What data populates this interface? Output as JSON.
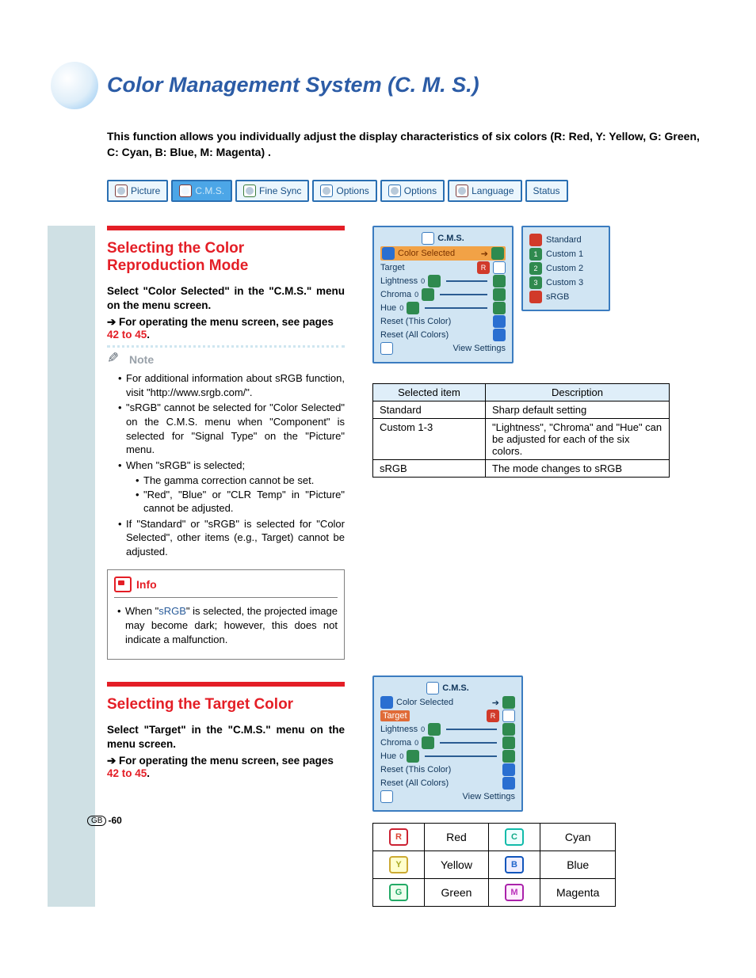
{
  "page": {
    "title": "Color Management System (C. M. S.)",
    "intro": "This function allows you individually adjust the display characteristics of six colors (R: Red, Y: Yellow, G: Green, C: Cyan, B: Blue, M: Magenta) .",
    "footer_region": "GB",
    "footer_page": "-60"
  },
  "tabs": [
    {
      "label": "Picture"
    },
    {
      "label": "C.M.S."
    },
    {
      "label": "Fine Sync"
    },
    {
      "label": "Options"
    },
    {
      "label": "Options"
    },
    {
      "label": "Language"
    },
    {
      "label": "Status"
    }
  ],
  "section1": {
    "title": "Selecting the Color Reproduction Mode",
    "lead": "Select \"Color Selected\" in the \"C.M.S.\" menu on the menu screen.",
    "arrow": "➔ For operating the menu screen, see pages ",
    "pageref": "42 to 45",
    "note_label": "Note",
    "notes": [
      "For additional information about sRGB function, visit \"http://www.srgb.com/\".",
      "\"sRGB\" cannot be selected for \"Color Selected\" on the C.M.S. menu when \"Component\" is selected for \"Signal Type\" on the \"Picture\" menu.",
      "When \"sRGB\" is selected;"
    ],
    "sub_notes": [
      "The gamma correction cannot be set.",
      "\"Red\", \"Blue\" or \"CLR Temp\" in \"Picture\" cannot be adjusted."
    ],
    "note_last": "If \"Standard\" or \"sRGB\" is selected for \"Color Selected\", other items (e.g., Target) cannot be adjusted.",
    "info_label": "Info",
    "info_pre": "When \"",
    "info_link": "sRGB",
    "info_post": "\" is selected, the projected image may become dark; however, this does not indicate a malfunction."
  },
  "section2": {
    "title": "Selecting the Target Color",
    "lead": "Select \"Target\" in the \"C.M.S.\" menu on the menu screen.",
    "arrow": "➔ For operating the menu screen, see pages ",
    "pageref": "42 to 45"
  },
  "osd1": {
    "header": "C.M.S.",
    "color_selected": "Color Selected",
    "rows": [
      "Target",
      "Lightness",
      "Chroma",
      "Hue",
      "Reset (This Color)",
      "Reset (All Colors)",
      "View Settings"
    ]
  },
  "popup": {
    "items": [
      "Standard",
      "Custom 1",
      "Custom 2",
      "Custom 3",
      "sRGB"
    ]
  },
  "desc_table": {
    "headers": [
      "Selected item",
      "Description"
    ],
    "rows": [
      [
        "Standard",
        "Sharp default setting"
      ],
      [
        "Custom 1-3",
        "\"Lightness\", \"Chroma\" and \"Hue\" can be adjusted for each of the six colors."
      ],
      [
        "sRGB",
        "The mode changes to sRGB"
      ]
    ]
  },
  "osd2": {
    "header": "C.M.S.",
    "color_selected": "Color Selected",
    "target": "Target",
    "rows": [
      "Lightness",
      "Chroma",
      "Hue",
      "Reset (This Color)",
      "Reset (All Colors)",
      "View Settings"
    ]
  },
  "color_table": [
    [
      "R",
      "Red",
      "C",
      "Cyan"
    ],
    [
      "Y",
      "Yellow",
      "B",
      "Blue"
    ],
    [
      "G",
      "Green",
      "M",
      "Magenta"
    ]
  ]
}
